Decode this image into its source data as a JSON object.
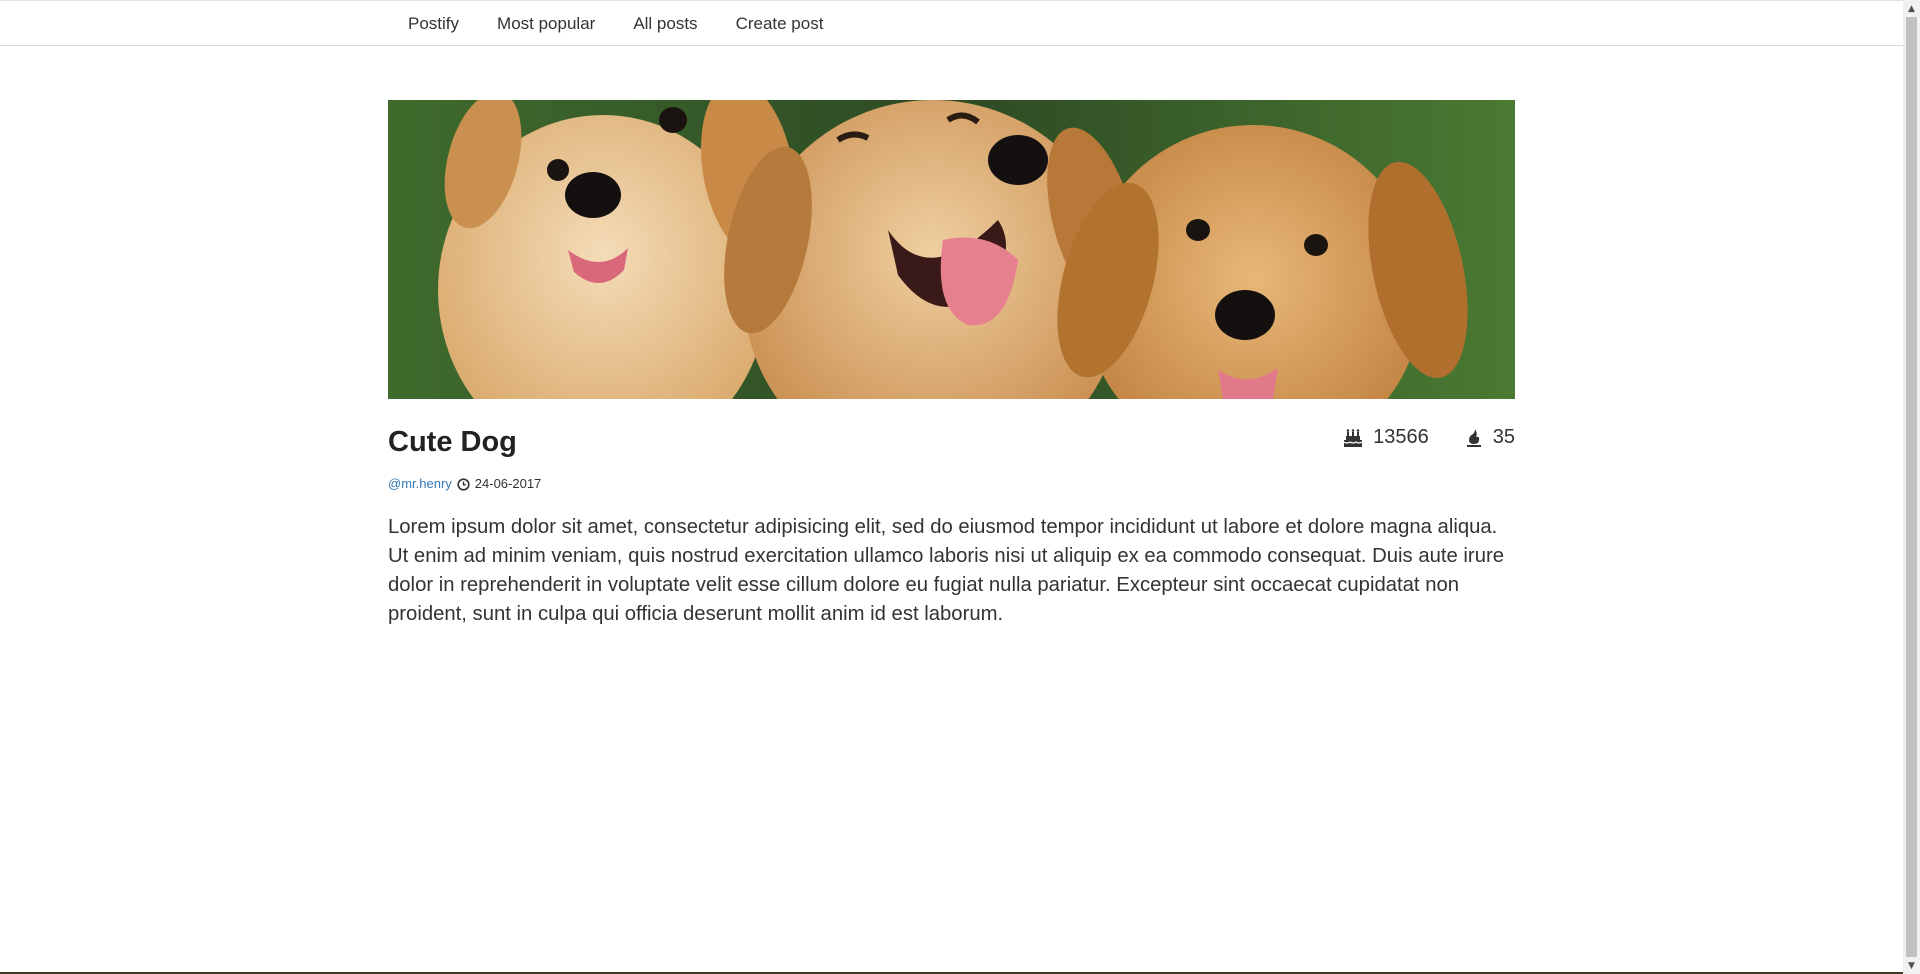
{
  "nav": {
    "items": [
      {
        "label": "Postify"
      },
      {
        "label": "Most popular"
      },
      {
        "label": "All posts"
      },
      {
        "label": "Create post"
      }
    ]
  },
  "post": {
    "title": "Cute Dog",
    "image": {
      "icon": "puppies-photo",
      "alt": "Three golden retriever puppies"
    },
    "stats": {
      "views": "13566",
      "views_icon": "birthday-cake-icon",
      "likes": "35",
      "likes_icon": "fire-icon"
    },
    "author": "@mr.henry",
    "date": "24-06-2017",
    "date_icon": "clock-icon",
    "body": "Lorem ipsum dolor sit amet, consectetur adipisicing elit, sed do eiusmod tempor incididunt ut labore et dolore magna aliqua. Ut enim ad minim veniam, quis nostrud exercitation ullamco laboris nisi ut aliquip ex ea commodo consequat. Duis aute irure dolor in reprehenderit in voluptate velit esse cillum dolore eu fugiat nulla pariatur. Excepteur sint occaecat cupidatat non proident, sunt in culpa qui officia deserunt mollit anim id est laborum."
  },
  "colors": {
    "link": "#337ab7",
    "text": "#333333",
    "title": "#222222"
  }
}
